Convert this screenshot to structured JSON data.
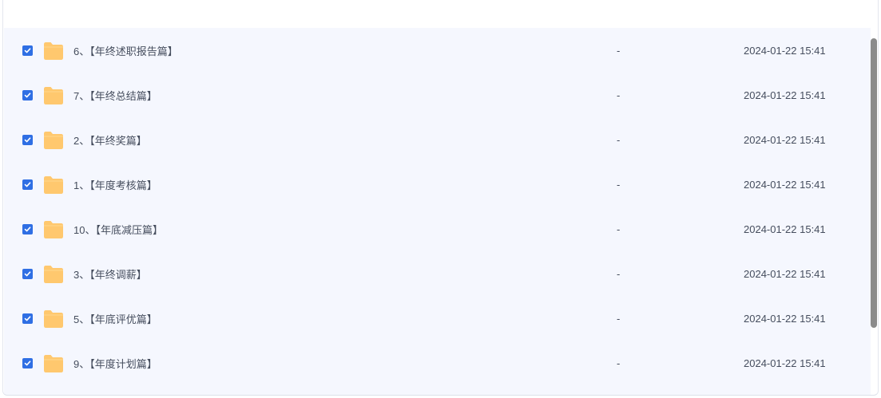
{
  "files": [
    {
      "name": "6、【年终述职报告篇】",
      "size": "-",
      "modified": "2024-01-22 15:41",
      "checked": true
    },
    {
      "name": "7、【年终总结篇】",
      "size": "-",
      "modified": "2024-01-22 15:41",
      "checked": true
    },
    {
      "name": "2、【年终奖篇】",
      "size": "-",
      "modified": "2024-01-22 15:41",
      "checked": true
    },
    {
      "name": "1、【年度考核篇】",
      "size": "-",
      "modified": "2024-01-22 15:41",
      "checked": true
    },
    {
      "name": "10、【年底减压篇】",
      "size": "-",
      "modified": "2024-01-22 15:41",
      "checked": true
    },
    {
      "name": "3、【年终调薪】",
      "size": "-",
      "modified": "2024-01-22 15:41",
      "checked": true
    },
    {
      "name": "5、【年底评优篇】",
      "size": "-",
      "modified": "2024-01-22 15:41",
      "checked": true
    },
    {
      "name": "9、【年度计划篇】",
      "size": "-",
      "modified": "2024-01-22 15:41",
      "checked": true
    }
  ],
  "icons": {
    "checkbox": "checkbox-checked-icon",
    "folder": "folder-icon"
  },
  "colors": {
    "accent": "#2f6fe4",
    "folder": "#ffc86e",
    "row_background": "#f5f7fe",
    "text": "#454d5d"
  }
}
